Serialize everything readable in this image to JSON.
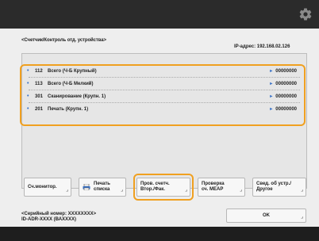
{
  "header": {
    "settings_icon": "gear-icon"
  },
  "screen": {
    "title": "<Счетчик/Контроль отд. устройства>",
    "ip_label": "IP-адрес: 192.168.02.126"
  },
  "list": {
    "rows": [
      {
        "num": "112",
        "name": "Всего (Ч-Б Крупный)",
        "count": "00000000"
      },
      {
        "num": "113",
        "name": "Всего (Ч-Б Мелкий)",
        "count": "00000000"
      },
      {
        "num": "301",
        "name": "Сканирование (Крупн. 1)",
        "count": "00000000"
      },
      {
        "num": "201",
        "name": "Печать (Крупн. 1)",
        "count": "00000000"
      }
    ]
  },
  "buttons": {
    "counter_label": "Сч.монитор.",
    "print_list_label_1": "Печать",
    "print_list_label_2": "списка",
    "check_device_label_1": "Пров. счетч.",
    "check_device_label_2": "Втор./Фак.",
    "check_mib_label_1": "Проверка",
    "check_mib_label_2": "сч. MEAP",
    "device_info_label_1": "Свед. об устр./",
    "device_info_label_2": "Другое"
  },
  "footer": {
    "serial_line_1": "<Серийный номер: XXXXXXXX>",
    "serial_line_2": "ID-ADR-XXXX (ВАXXXX)",
    "ok_label": "OK"
  },
  "colors": {
    "highlight": "#f0a020",
    "accent": "#3a73c8",
    "topbar": "#2b2b2b"
  }
}
